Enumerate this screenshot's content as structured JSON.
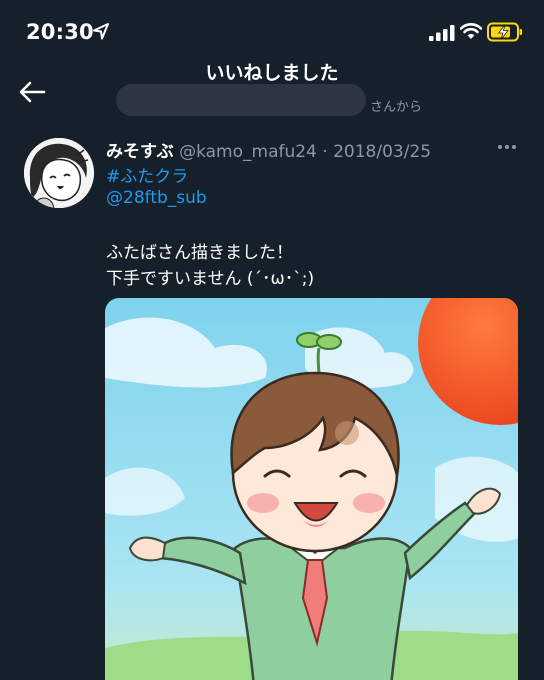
{
  "status_bar": {
    "time": "20:30"
  },
  "header": {
    "title": "いいねしました",
    "subtitle_suffix": "さんから"
  },
  "tweet": {
    "display_name": "みそすぶ",
    "handle": "@kamo_mafu24",
    "separator": "·",
    "date": "2018/03/25",
    "hashtag": "#ふたクラ",
    "mention": "@28ftb_sub",
    "body_line1": "ふたばさん描きました！",
    "body_line2": "下手ですいません (´･ω･`;)"
  },
  "colors": {
    "background": "#15202b",
    "link": "#1d9bf0",
    "secondary_text": "#8b98a5"
  },
  "icons": [
    "location-arrow-icon",
    "signal-icon",
    "wifi-icon",
    "battery-charging-icon",
    "back-arrow-icon",
    "more-icon"
  ]
}
